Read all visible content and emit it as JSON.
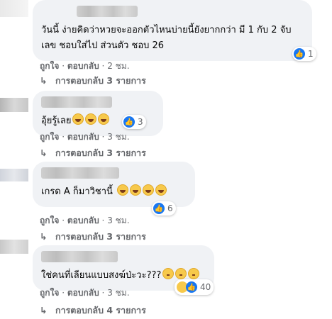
{
  "comments": [
    {
      "text": "วันนี้ ง่ายคิดว่าหวยจะออกตัวไหนบ่ายนี้ยังยากกว่า มี 1 กับ 2 จับ\nเลข ชอบใส่ไป ส่วนตัว ชอบ 26",
      "reaction_count": "1",
      "like_label": "ถูกใจ",
      "reply_label": "ตอบกลับ",
      "time": "2 ชม.",
      "replies": "การตอบกลับ 3 รายการ"
    },
    {
      "text": "อุ้ยรู้เลย",
      "reaction_count": "3",
      "like_label": "ถูกใจ",
      "reply_label": "ตอบกลับ",
      "time": "3 ชม.",
      "replies": "การตอบกลับ 3 รายการ"
    },
    {
      "text": "เกรด A ก็มาวิชานี้",
      "reaction_count": "6",
      "like_label": "ถูกใจ",
      "reply_label": "ตอบกลับ",
      "time": "3 ชม.",
      "replies": "การตอบกลับ 3 รายการ"
    },
    {
      "text": "ใช่คนที่เลียนแบบสงฆ์ป่ะวะ???",
      "reaction_count": "40",
      "like_label": "ถูกใจ",
      "reply_label": "ตอบกลับ",
      "time": "3 ชม.",
      "replies": "การตอบกลับ 4 รายการ"
    }
  ],
  "icons": {
    "like": "thumbs-up-icon",
    "haha": "laugh-emoji-icon",
    "reply": "reply-arrow-icon"
  },
  "colors": {
    "like_blue": "#1877f2",
    "bubble": "#f0f2f5",
    "meta": "#65676b"
  }
}
